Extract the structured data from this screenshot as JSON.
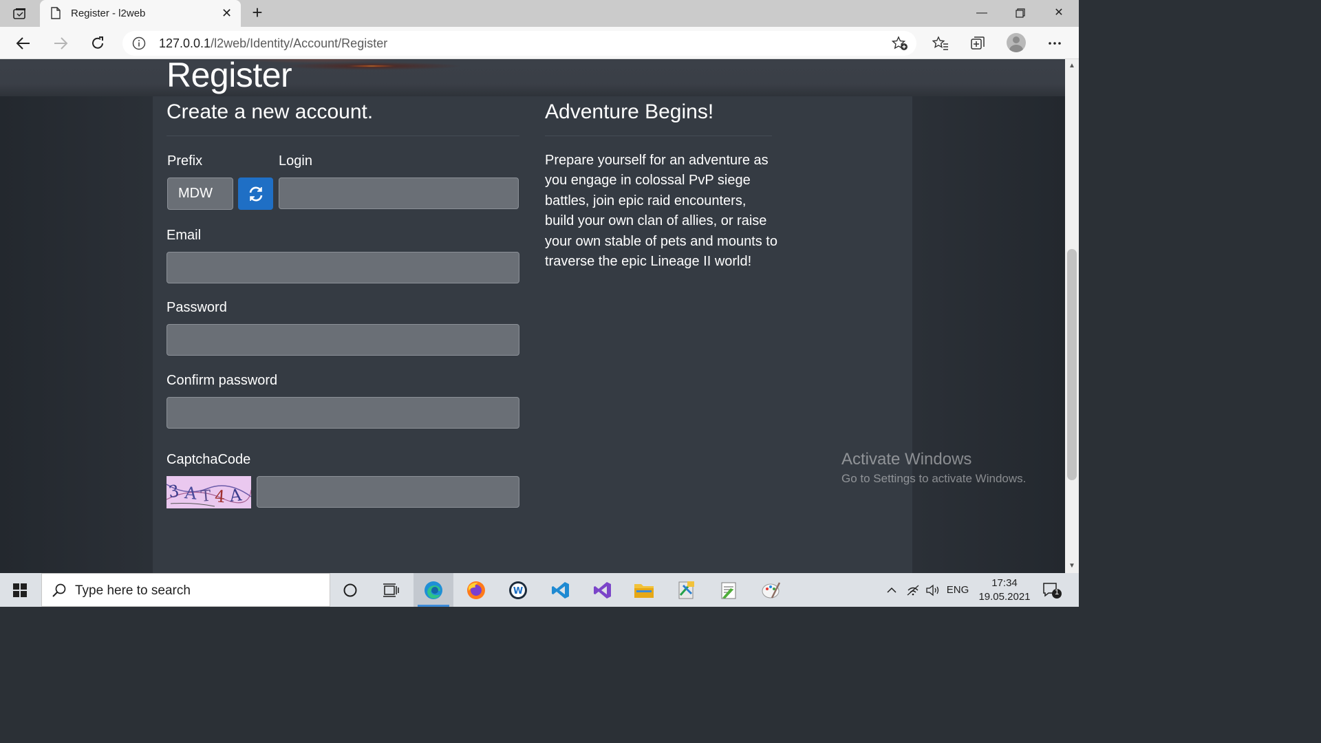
{
  "browser": {
    "tab_title": "Register - l2web",
    "url_host": "127.0.0.1",
    "url_path": "/l2web/Identity/Account/Register"
  },
  "page": {
    "heading": "Register",
    "subheading": "Create a new account.",
    "form": {
      "prefix_label": "Prefix",
      "prefix_value": "MDW",
      "login_label": "Login",
      "email_label": "Email",
      "password_label": "Password",
      "confirm_password_label": "Confirm password",
      "captcha_label": "CaptchaCode",
      "captcha_image_text": "3AT4A"
    },
    "sidebar": {
      "heading": "Adventure Begins!",
      "text": "Prepare yourself for an adventure as you engage in colossal PvP siege battles, join epic raid encounters, build your own clan of allies, or raise your own stable of pets and mounts to traverse the epic Lineage II world!"
    }
  },
  "watermark": {
    "line1": "Activate Windows",
    "line2": "Go to Settings to activate Windows."
  },
  "taskbar": {
    "search_placeholder": "Type here to search",
    "language": "ENG",
    "time": "17:34",
    "date": "19.05.2021",
    "notification_count": "1"
  }
}
